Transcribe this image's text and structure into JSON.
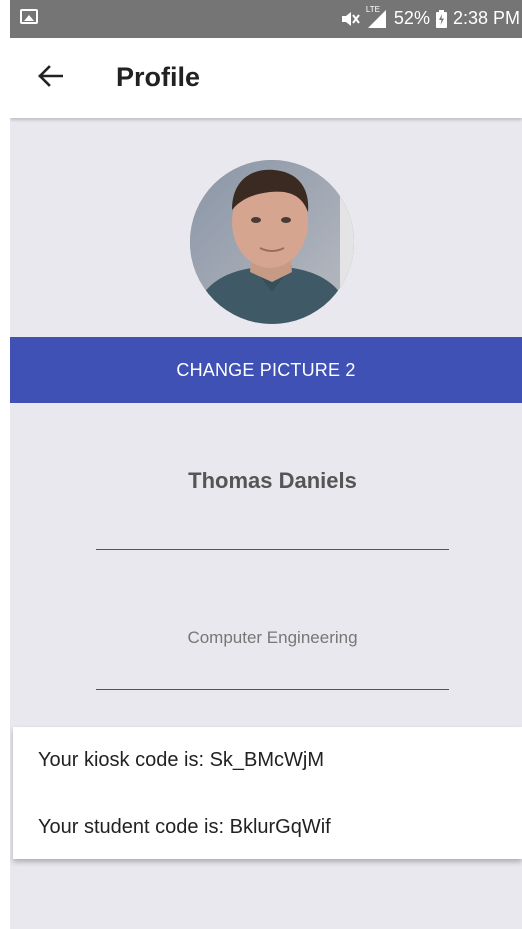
{
  "status_bar": {
    "battery_percent": "52%",
    "time": "2:38 PM",
    "network_label": "LTE",
    "left_icon": "gallery-icon",
    "icons": [
      "mute-icon",
      "signal-icon",
      "battery-charging-icon"
    ]
  },
  "app_bar": {
    "back_icon": "arrow-back-icon",
    "title": "Profile"
  },
  "profile": {
    "change_picture_label": "CHANGE PICTURE 2",
    "name": "Thomas Daniels",
    "major": "Computer Engineering"
  },
  "codes": {
    "kiosk_line": "Your kiosk code is: Sk_BMcWjM",
    "student_line": "Your student code is: BklurGqWif"
  },
  "colors": {
    "accent": "#3f51b5",
    "background": "#e8e8ee",
    "status_bar": "#757575"
  }
}
